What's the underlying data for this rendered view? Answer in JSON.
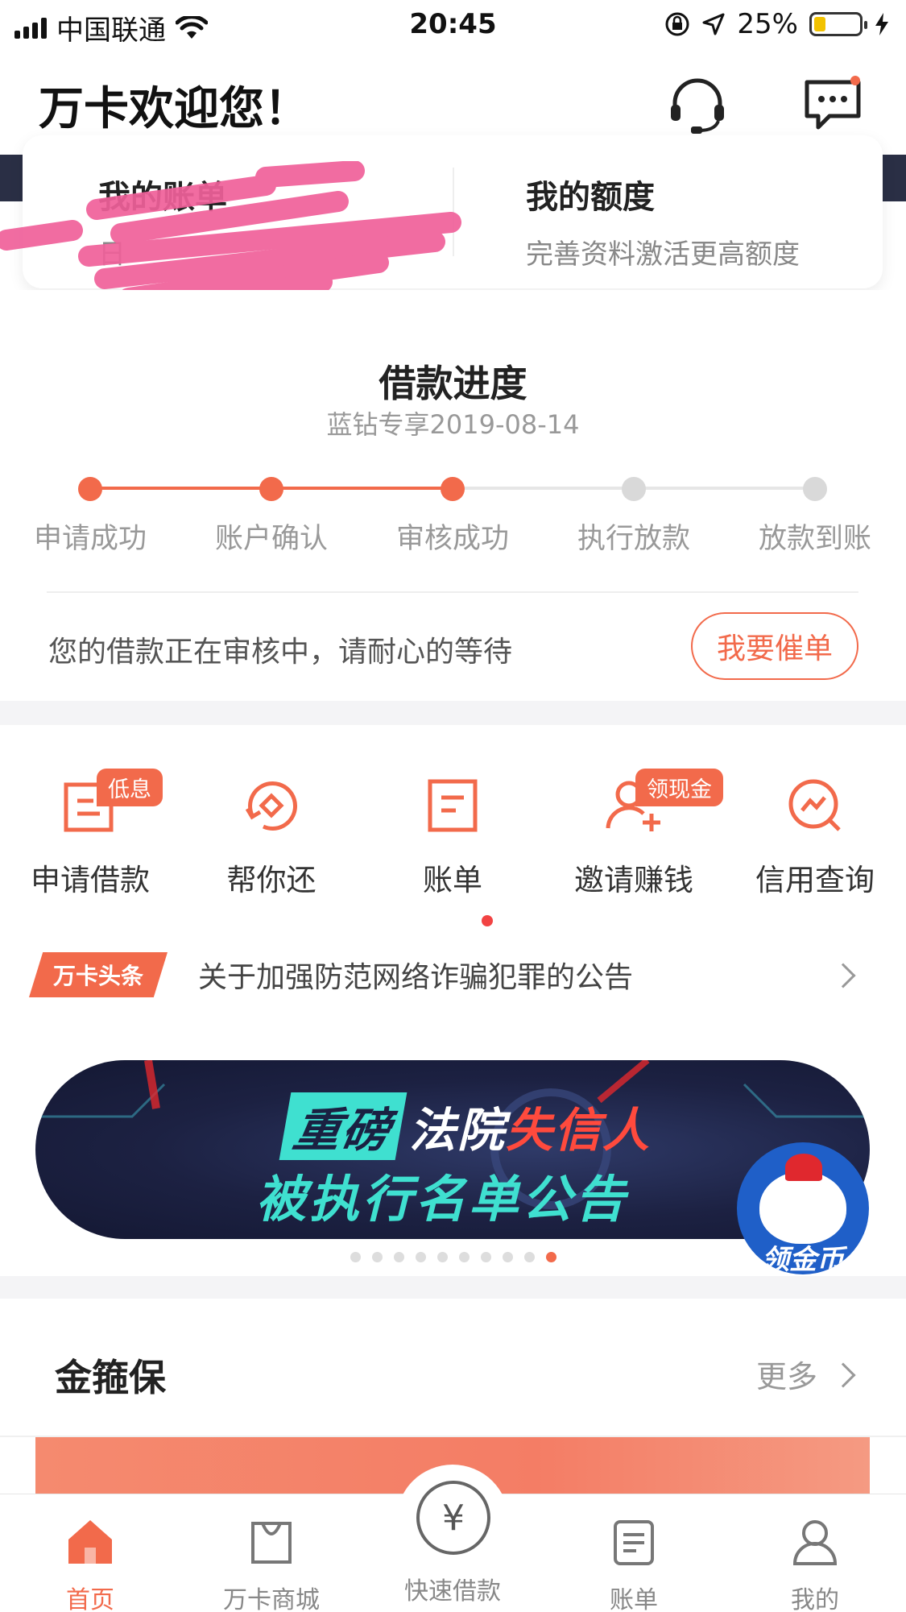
{
  "status_bar": {
    "carrier": "中国联通",
    "time": "20:45",
    "battery": "25%"
  },
  "header": {
    "welcome": "万卡欢迎您！",
    "icons": [
      "headset-icon",
      "message-icon"
    ]
  },
  "account_card": {
    "bill_title": "我的账单",
    "bill_sub": "日",
    "quota_title": "我的额度",
    "quota_sub": "完善资料激活更高额度"
  },
  "loan_progress": {
    "title": "借款进度",
    "subtitle": "蓝钻专享2019-08-14",
    "steps": [
      "申请成功",
      "账户确认",
      "审核成功",
      "执行放款",
      "放款到账"
    ],
    "completed_steps": 3,
    "message": "您的借款正在审核中，请耐心的等待",
    "urge_button": "我要催单",
    "colors": {
      "active": "#f26a4b",
      "inactive": "#d9d9d9"
    }
  },
  "quick_entries": [
    {
      "label": "申请借款",
      "tag": "低息",
      "icon": "apply-loan-icon"
    },
    {
      "label": "帮你还",
      "tag": "",
      "icon": "repay-icon"
    },
    {
      "label": "账单",
      "tag": "",
      "icon": "bill-icon",
      "dot": true
    },
    {
      "label": "邀请赚钱",
      "tag": "领现金",
      "icon": "invite-icon"
    },
    {
      "label": "信用查询",
      "tag": "",
      "icon": "credit-query-icon"
    }
  ],
  "headline": {
    "tag": "万卡头条",
    "text": "关于加强防范网络诈骗犯罪的公告"
  },
  "banner": {
    "tag": "重磅",
    "line1_a": "法院",
    "line1_b": "失信人",
    "line2": "被执行名单公告",
    "float_text": "领金币",
    "page_count": 10,
    "active_page": 10
  },
  "insurance": {
    "title": "金箍保",
    "more": "更多"
  },
  "tab_bar": {
    "tabs": [
      "首页",
      "万卡商城",
      "快速借款",
      "账单",
      "我的"
    ],
    "active": "首页",
    "center_symbol": "¥"
  },
  "theme": {
    "accent": "#f26a4b",
    "dark_band": "#2a2f45"
  }
}
